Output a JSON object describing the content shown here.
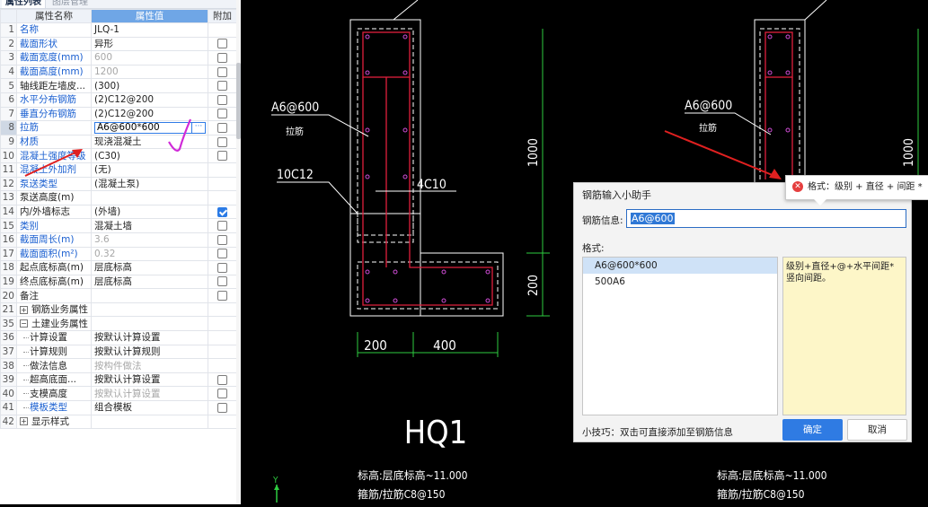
{
  "tabs": {
    "active": "属性列表",
    "inactive": "图层管理"
  },
  "columns": {
    "name": "属性名称",
    "value": "属性值",
    "extra": "附加"
  },
  "rows": [
    {
      "num": "1",
      "name": "名称",
      "value": "JLQ-1",
      "name_color": "blue",
      "value_style": "dark",
      "check": "none"
    },
    {
      "num": "2",
      "name": "截面形状",
      "value": "异形",
      "name_color": "blue",
      "value_style": "dark",
      "check": "off"
    },
    {
      "num": "3",
      "name": "截面宽度(mm)",
      "value": "600",
      "name_color": "blue",
      "value_style": "gray",
      "check": "off"
    },
    {
      "num": "4",
      "name": "截面高度(mm)",
      "value": "1200",
      "name_color": "blue",
      "value_style": "gray",
      "check": "off"
    },
    {
      "num": "5",
      "name": "轴线距左墙皮...",
      "value": "(300)",
      "name_color": "dark",
      "value_style": "dark",
      "check": "off"
    },
    {
      "num": "6",
      "name": "水平分布钢筋",
      "value": "(2)C12@200",
      "name_color": "blue",
      "value_style": "dark",
      "check": "off"
    },
    {
      "num": "7",
      "name": "垂直分布钢筋",
      "value": "(2)C12@200",
      "name_color": "blue",
      "value_style": "dark",
      "check": "off"
    },
    {
      "num": "8",
      "name": "拉筋",
      "value": "A6@600*600",
      "name_color": "blue",
      "value_style": "edit",
      "check": "off"
    },
    {
      "num": "9",
      "name": "材质",
      "value": "现浇混凝土",
      "name_color": "blue",
      "value_style": "dark",
      "check": "off"
    },
    {
      "num": "10",
      "name": "混凝土强度等级",
      "value": "(C30)",
      "name_color": "blue",
      "value_style": "dark",
      "check": "off"
    },
    {
      "num": "11",
      "name": "混凝土外加剂",
      "value": "(无)",
      "name_color": "blue",
      "value_style": "dark",
      "check": "none"
    },
    {
      "num": "12",
      "name": "泵送类型",
      "value": "(混凝土泵)",
      "name_color": "blue",
      "value_style": "dark",
      "check": "none"
    },
    {
      "num": "13",
      "name": "泵送高度(m)",
      "value": "",
      "name_color": "dark",
      "value_style": "dark",
      "check": "none"
    },
    {
      "num": "14",
      "name": "内/外墙标志",
      "value": "(外墙)",
      "name_color": "dark",
      "value_style": "dark",
      "check": "on"
    },
    {
      "num": "15",
      "name": "类别",
      "value": "混凝土墙",
      "name_color": "blue",
      "value_style": "dark",
      "check": "off"
    },
    {
      "num": "16",
      "name": "截面周长(m)",
      "value": "3.6",
      "name_color": "blue",
      "value_style": "gray",
      "check": "off"
    },
    {
      "num": "17",
      "name": "截面面积(m²)",
      "value": "0.32",
      "name_color": "blue",
      "value_style": "gray",
      "check": "off"
    },
    {
      "num": "18",
      "name": "起点底标高(m)",
      "value": "层底标高",
      "name_color": "dark",
      "value_style": "dark",
      "check": "off"
    },
    {
      "num": "19",
      "name": "终点底标高(m)",
      "value": "层底标高",
      "name_color": "dark",
      "value_style": "dark",
      "check": "off"
    },
    {
      "num": "20",
      "name": "备注",
      "value": "",
      "name_color": "dark",
      "value_style": "dark",
      "check": "off"
    },
    {
      "num": "21",
      "name": "钢筋业务属性",
      "value": "",
      "name_color": "dark",
      "value_style": "dark",
      "check": "none",
      "expander": "+"
    },
    {
      "num": "35",
      "name": "土建业务属性",
      "value": "",
      "name_color": "dark",
      "value_style": "dark",
      "check": "none",
      "expander": "−"
    },
    {
      "num": "36",
      "name": "计算设置",
      "value": "按默认计算设置",
      "name_color": "dark",
      "value_style": "dark",
      "check": "none",
      "indent": true
    },
    {
      "num": "37",
      "name": "计算规则",
      "value": "按默认计算规则",
      "name_color": "dark",
      "value_style": "dark",
      "check": "none",
      "indent": true
    },
    {
      "num": "38",
      "name": "做法信息",
      "value": "按构件做法",
      "name_color": "dark",
      "value_style": "gray",
      "check": "none",
      "indent": true
    },
    {
      "num": "39",
      "name": "超高底面...",
      "value": "按默认计算设置",
      "name_color": "dark",
      "value_style": "dark",
      "check": "off",
      "indent": true
    },
    {
      "num": "40",
      "name": "支模高度",
      "value": "按默认计算设置",
      "name_color": "dark",
      "value_style": "gray",
      "check": "off",
      "indent": true
    },
    {
      "num": "41",
      "name": "模板类型",
      "value": "组合模板",
      "name_color": "blue",
      "value_style": "dark",
      "check": "off",
      "indent": true
    },
    {
      "num": "42",
      "name": "显示样式",
      "value": "",
      "name_color": "dark",
      "value_style": "dark",
      "check": "none",
      "expander": "+"
    }
  ],
  "drawing": {
    "dim_1000": "1000",
    "dim_200": "200",
    "dim_w1": "200",
    "dim_w2": "400",
    "label_a6": "A6@600",
    "label_lajin": "拉筋",
    "label_10c12": "10C12",
    "label_4c10": "4C10",
    "label_hq1": "HQ1",
    "elev_line": "标高:层底标高~11.000",
    "stirrup_line": "箍筋/拉筋C8@150"
  },
  "dialog": {
    "title": "钢筋输入小助手",
    "info_label": "钢筋信息:",
    "info_value": "A6@600",
    "format_label": "格式:",
    "formats": [
      "A6@600*600",
      "500A6"
    ],
    "format_desc": "级别+直径+@+水平间距*竖向间距。",
    "tip": "小技巧：双击可直接添加至钢筋信息",
    "ok": "确定",
    "cancel": "取消"
  },
  "tooltip": {
    "text": "格式：级别 + 直径 + 间距 *"
  },
  "colors": {
    "header_blue": "#6fa6e6",
    "cad_red": "#e0203c",
    "cad_white": "#ffffff",
    "accent": "#2f7be3",
    "annotation_red": "#e02020",
    "annotation_magenta": "#d02ad8"
  }
}
